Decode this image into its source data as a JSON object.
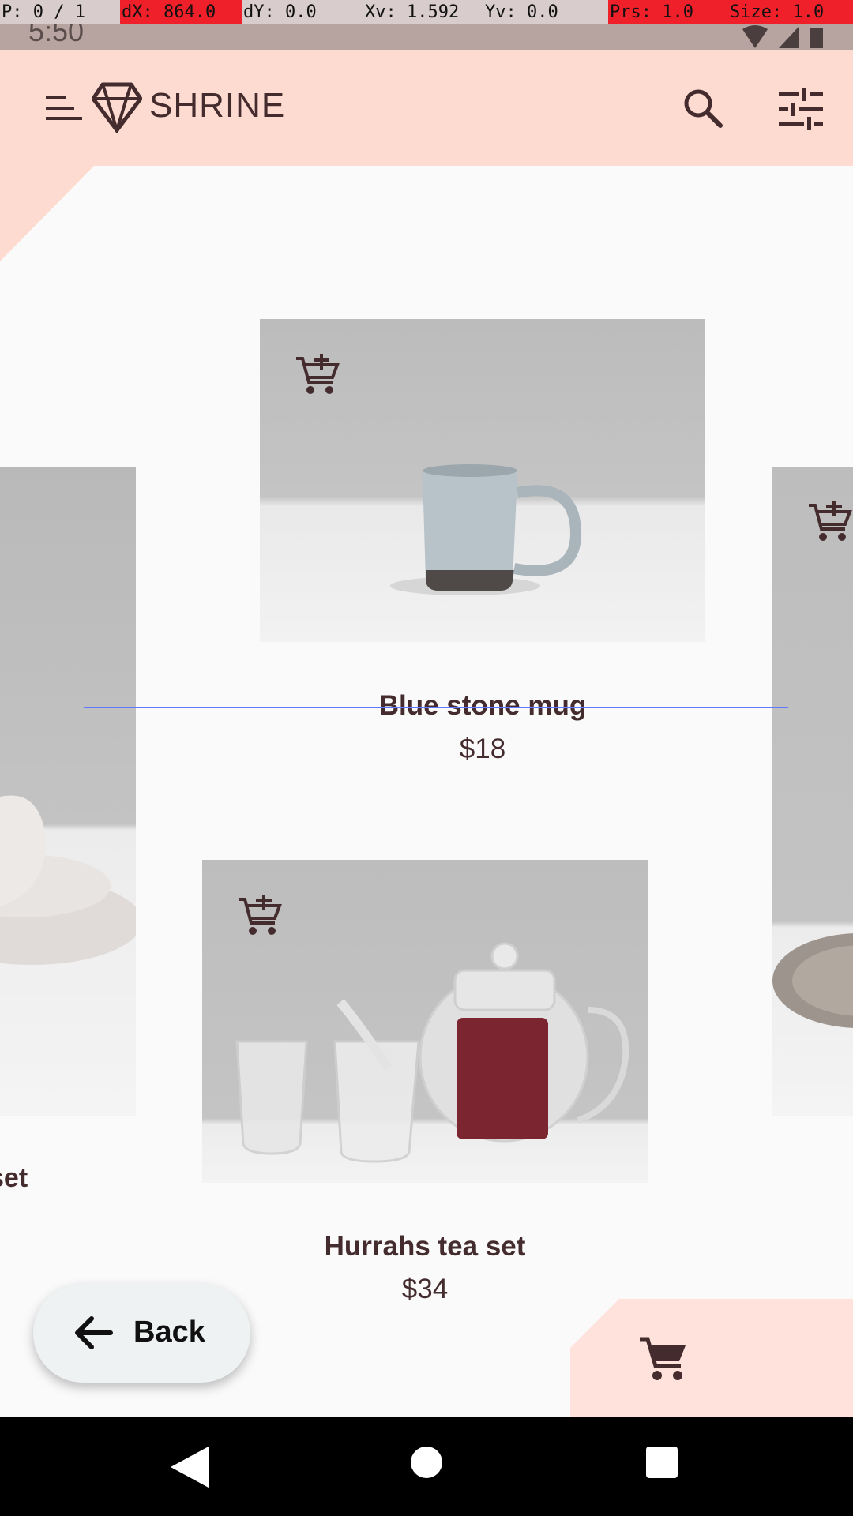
{
  "debug_overlay": {
    "pointer": "P: 0 / 1",
    "dx": "dX: 864.0",
    "dy": "dY: 0.0",
    "xv": "Xv: 1.592",
    "yv": "Yv: 0.0",
    "prs": "Prs: 1.0",
    "size": "Size: 1.0"
  },
  "status_bar": {
    "time": "5:50"
  },
  "app_bar": {
    "brand": "SHRINE",
    "menu_icon": "menu-icon",
    "logo_icon": "diamond-logo-icon",
    "search_icon": "search-icon",
    "filter_icon": "tune-icon"
  },
  "products": [
    {
      "title": "Blue stone mug",
      "price": "$18",
      "image": "blue stone mug photo"
    },
    {
      "title": "Hurrahs tea set",
      "price": "$34",
      "image": "glass tea set photo"
    }
  ],
  "side_cards": {
    "left_partial_label": "set"
  },
  "back_button": {
    "label": "Back"
  },
  "colors": {
    "primary": "#fedbd0",
    "on_primary": "#442c2e",
    "surface": "#fafafa",
    "debug_red": "#f0202a"
  }
}
